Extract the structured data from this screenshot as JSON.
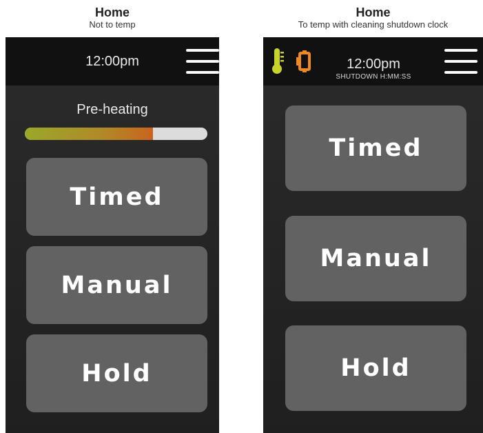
{
  "left_screen": {
    "caption_title": "Home",
    "caption_subtitle": "Not to temp",
    "clock": "12:00pm",
    "status_label": "Pre-heating",
    "preheat_progress": 0.7,
    "buttons": [
      "Timed",
      "Manual",
      "Hold"
    ]
  },
  "right_screen": {
    "caption_title": "Home",
    "caption_subtitle": "To temp with cleaning shutdown clock",
    "clock": "12:00pm",
    "shutdown_text": "SHUTDOWN H:MM:SS",
    "icons": [
      "thermometer-icon",
      "door-icon"
    ],
    "buttons": [
      "Timed",
      "Manual",
      "Hold"
    ]
  },
  "colors": {
    "topbar": "#111111",
    "screen_bg": "#252525",
    "button_bg": "#626262",
    "thermometer": "#c8d42a",
    "door_icon": "#f08a1c",
    "progress_start": "#9aa82a",
    "progress_end": "#c9641e",
    "progress_track": "#dcdcdc"
  }
}
